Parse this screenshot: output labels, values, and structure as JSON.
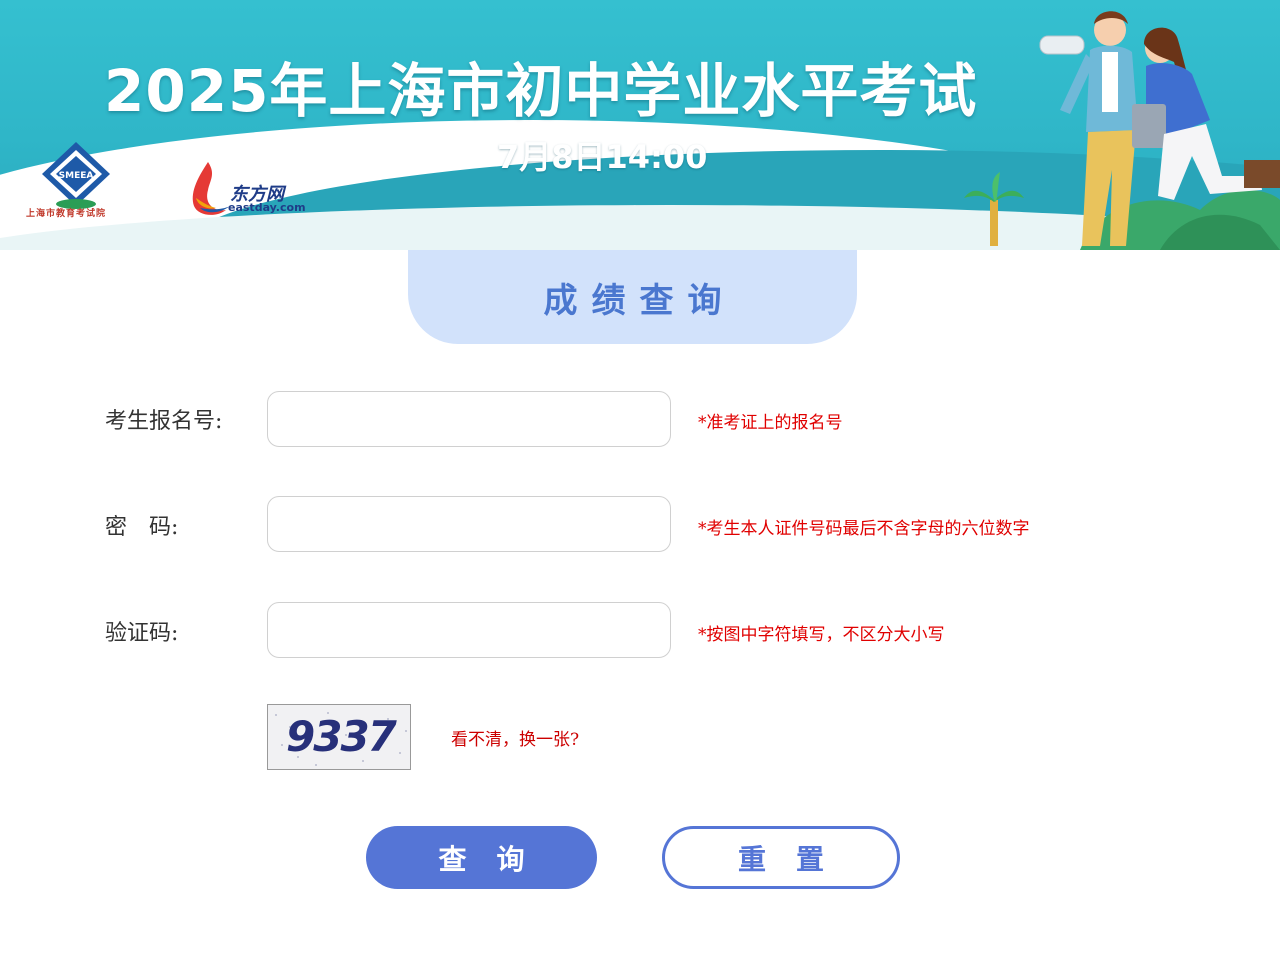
{
  "banner": {
    "title": "2025年上海市初中学业水平考试",
    "date": "7月8日14:00",
    "logo_smeea_text": "SMEEA",
    "logo_smeea_caption": "上海市教育考试院",
    "logo_eastday_name": "东方网",
    "logo_eastday_domain": "eastday.com"
  },
  "section": {
    "title": "成绩查询"
  },
  "form": {
    "fields": [
      {
        "label": "考生报名号:",
        "value": "",
        "hint": "*准考证上的报名号"
      },
      {
        "label": "密　码:",
        "value": "",
        "hint": "*考生本人证件号码最后不含字母的六位数字"
      },
      {
        "label": "验证码:",
        "value": "",
        "hint": "*按图中字符填写，不区分大小写"
      }
    ],
    "captcha_text": "9337",
    "refresh_label": "看不清，换一张?",
    "submit_label": "查询",
    "reset_label": "重置"
  },
  "colors": {
    "banner_bg": "#35c0d0",
    "accent_blue": "#5575d6",
    "tab_bg": "#d2e2fb",
    "hint_red": "#e00000"
  }
}
